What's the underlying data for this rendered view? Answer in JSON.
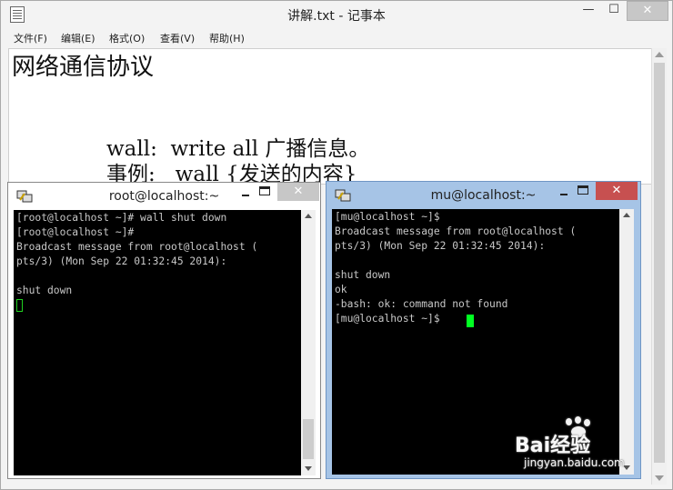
{
  "notepad": {
    "title": "讲解.txt - 记事本",
    "controls": {
      "min": "—",
      "max": "☐",
      "close": "✕"
    },
    "menu": [
      "文件(F)",
      "编辑(E)",
      "格式(O)",
      "查看(V)",
      "帮助(H)"
    ],
    "lines": [
      "网络通信协议",
      "wall:  write all 广播信息。",
      "事例:   wall {发送的内容}"
    ]
  },
  "terminal_root": {
    "title": "root@localhost:~",
    "close": "✕",
    "lines": [
      "[root@localhost ~]# wall shut down",
      "[root@localhost ~]#",
      "Broadcast message from root@localhost (",
      "pts/3) (Mon Sep 22 01:32:45 2014):",
      "",
      "shut down"
    ]
  },
  "terminal_mu": {
    "title": "mu@localhost:~",
    "close": "✕",
    "lines": [
      "[mu@localhost ~]$",
      "Broadcast message from root@localhost (",
      "pts/3) (Mon Sep 22 01:32:45 2014):",
      "",
      "shut down",
      "ok",
      "-bash: ok: command not found",
      "[mu@localhost ~]$"
    ]
  },
  "watermark": {
    "brand": "Bai经验",
    "url": "jingyan.baidu.com"
  },
  "colors": {
    "terminal_bg": "#000000",
    "terminal_text": "#c8c8c8",
    "cursor": "#00ff22",
    "active_frame": "#a6c4e6",
    "close_button": "#c75050"
  }
}
